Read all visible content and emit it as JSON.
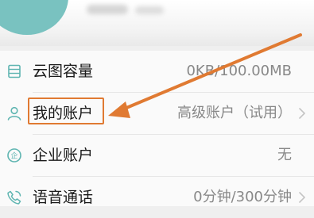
{
  "colors": {
    "icon_teal": "#5fb5b1",
    "annotation_orange": "#e07a32"
  },
  "menu": {
    "items": [
      {
        "label": "云图容量",
        "value": "0KB/100.00MB",
        "icon": "storage-icon"
      },
      {
        "label": "我的账户",
        "value": "高级账户（试用）",
        "icon": "user-icon"
      },
      {
        "label": "企业账户",
        "value": "无",
        "icon": "enterprise-icon"
      },
      {
        "label": "语音通话",
        "value": "0分钟/300分钟",
        "icon": "phone-icon"
      }
    ]
  }
}
